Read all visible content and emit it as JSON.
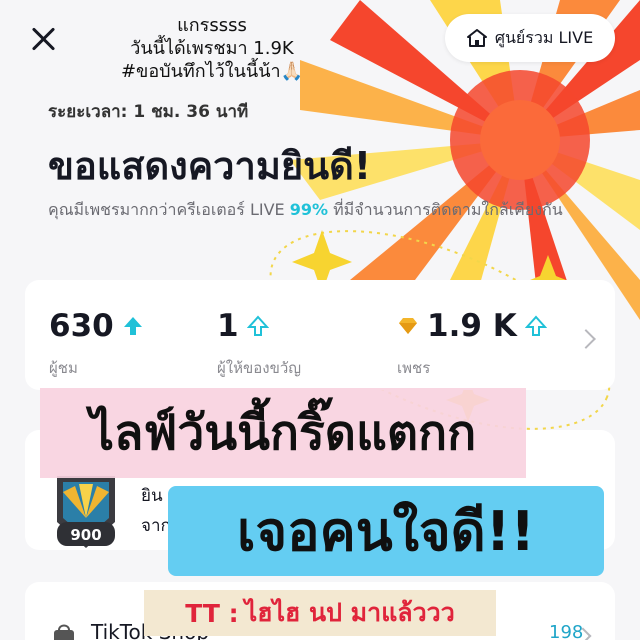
{
  "header": {
    "caption_lines": [
      "แกรssss",
      "วันนี้ได้เพรชมา 1.9K",
      "#ขอบันทึกไว้ในนี้น้า🙏🏻"
    ],
    "live_center_label": "ศูนย์รวม LIVE"
  },
  "summary": {
    "duration": "ระยะเวลา: 1 ชม. 36 นาที",
    "headline": "ขอแสดงความยินดี!",
    "subtext_before": "คุณมีเพชรมากกว่าครีเอเตอร์ LIVE ",
    "subtext_pct": "99%",
    "subtext_after": " ที่มีจำนวนการติดตามใกล้เคียงกัน"
  },
  "stats": [
    {
      "value": "630",
      "label": "ผู้ชม",
      "icon": "up-arrow-icon"
    },
    {
      "value": "1",
      "label": "ผู้ให้ของขวัญ",
      "icon": "up-arrow-icon"
    },
    {
      "value": "1.9 K",
      "label": "เพชร",
      "icon": "diamond-icon"
    }
  ],
  "rank": {
    "badge_number": "900",
    "line1": "ยิน",
    "line2": "จาก"
  },
  "bottom": {
    "title": "TikTok Shop",
    "count": "198"
  },
  "overlays": {
    "pink": "ไลฟ์วันนี้กริ๊ดแตกก",
    "blue": "เจอคนใจดี!!",
    "beige_tt": "TT :",
    "beige_text": "ไฮไฮ นป มาแล้ววว"
  },
  "colors": {
    "accent_cyan": "#20c1d8",
    "burst_red": "#f5462d",
    "burst_yellow": "#fdd64a",
    "overlay_blue": "#64cdf2",
    "overlay_pink": "#f8d2e0"
  }
}
